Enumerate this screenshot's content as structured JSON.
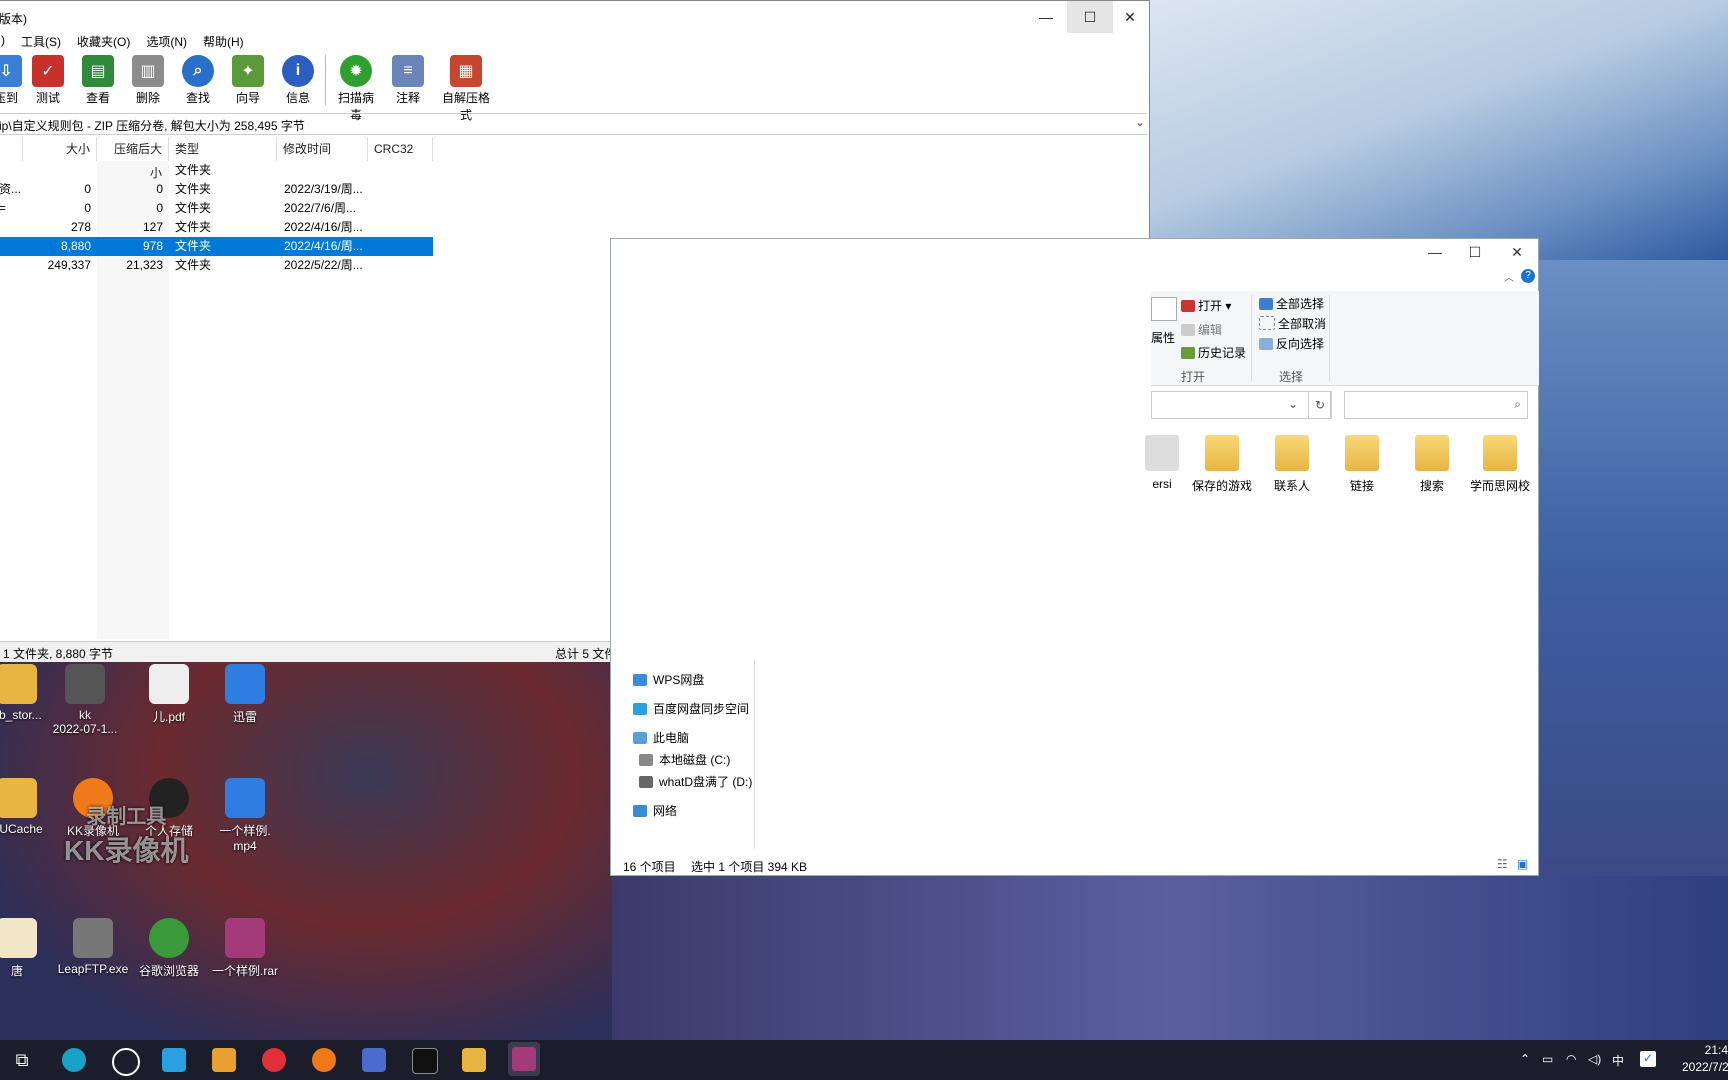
{
  "rar": {
    "title": "版本)",
    "menu": [
      ")",
      "工具(S)",
      "收藏夹(O)",
      "选项(N)",
      "帮助(H)"
    ],
    "toolbar": [
      {
        "label": "压到",
        "icon": "extract-icon",
        "color": "#3a7fd5"
      },
      {
        "label": "测试",
        "icon": "test-icon",
        "color": "#c8302c"
      },
      {
        "label": "查看",
        "icon": "view-book-icon",
        "color": "#2f8a3c"
      },
      {
        "label": "删除",
        "icon": "trash-icon",
        "color": "#8c8c8c"
      },
      {
        "label": "查找",
        "icon": "magnifier-icon",
        "color": "#2a6fc9"
      },
      {
        "label": "向导",
        "icon": "wand-icon",
        "color": "#5b9a3a"
      },
      {
        "label": "信息",
        "icon": "info-icon",
        "color": "#2c5ec2"
      },
      {
        "label": "扫描病毒",
        "icon": "virus-scan-icon",
        "color": "#2fa02f"
      },
      {
        "label": "注释",
        "icon": "comment-icon",
        "color": "#6a86b8"
      },
      {
        "label": "自解压格式",
        "icon": "sfx-box-icon",
        "color": "#c9462e"
      }
    ],
    "address": "ip\\自定义规则包 - ZIP 压缩分卷, 解包大小为 258,495 字节",
    "columns": [
      "大小",
      "压缩后大小",
      "类型",
      "修改时间",
      "CRC32"
    ],
    "rows": [
      {
        "name": "",
        "size": "",
        "packed": "",
        "type": "文件夹",
        "modified": ""
      },
      {
        "name": "资...",
        "size": "0",
        "packed": "0",
        "type": "文件夹",
        "modified": "2022/3/19/周..."
      },
      {
        "name": "=",
        "size": "0",
        "packed": "0",
        "type": "文件夹",
        "modified": "2022/7/6/周..."
      },
      {
        "name": "",
        "size": "278",
        "packed": "127",
        "type": "文件夹",
        "modified": "2022/4/16/周..."
      },
      {
        "name": "",
        "size": "8,880",
        "packed": "978",
        "type": "文件夹",
        "modified": "2022/4/16/周..."
      },
      {
        "name": "",
        "size": "249,337",
        "packed": "21,323",
        "type": "文件夹",
        "modified": "2022/5/22/周..."
      }
    ],
    "selected_row": 4,
    "status_left": "1 文件夹, 8,880 字节",
    "status_right": "总计 5 文件夹, 258,495 字节"
  },
  "explorer": {
    "ribbon": {
      "properties": "属性",
      "open": "打开",
      "edit": "编辑",
      "history": "历史记录",
      "select_all": "全部选择",
      "select_none": "全部取消",
      "invert": "反向选择",
      "group_open": "打开",
      "group_select": "选择"
    },
    "folders": [
      "ersi",
      "保存的游戏",
      "联系人",
      "链接",
      "搜索",
      "学而思网校"
    ],
    "nav": [
      "WPS网盘",
      "百度网盘同步空间",
      "此电脑",
      "本地磁盘 (C:)",
      "whatD盘满了 (D:)",
      "网络"
    ],
    "status_count": "16 个项目",
    "status_selected": "选中 1 个项目  394 KB"
  },
  "desktop": {
    "icons": [
      {
        "label": "ob_stor...",
        "color": "#e8b543"
      },
      {
        "label": "kk\n2022-07-1...",
        "color": "#555"
      },
      {
        "label": "儿.pdf",
        "color": "#eee"
      },
      {
        "label": "迅雷",
        "color": "#2f7de0"
      },
      {
        "label": "PUCache",
        "color": "#e8b543"
      },
      {
        "label": "KK录像机",
        "color": "#f07a1a"
      },
      {
        "label": "个人存储",
        "color": "#222"
      },
      {
        "label": "一个样例.\nmp4",
        "color": "#2f7de0"
      },
      {
        "label": "唐",
        "color": "#f2e6c8"
      },
      {
        "label": "LeapFTP.exe",
        "color": "#777"
      },
      {
        "label": "谷歌浏览器",
        "color": "#3a9a3a"
      },
      {
        "label": "一个样例.rar",
        "color": "#a33a7a"
      }
    ],
    "watermark_1": "录制工具",
    "watermark_2": "KK录像机"
  },
  "taskbar": {
    "ime": "中",
    "time": "21:4",
    "date": "2022/7/2"
  }
}
